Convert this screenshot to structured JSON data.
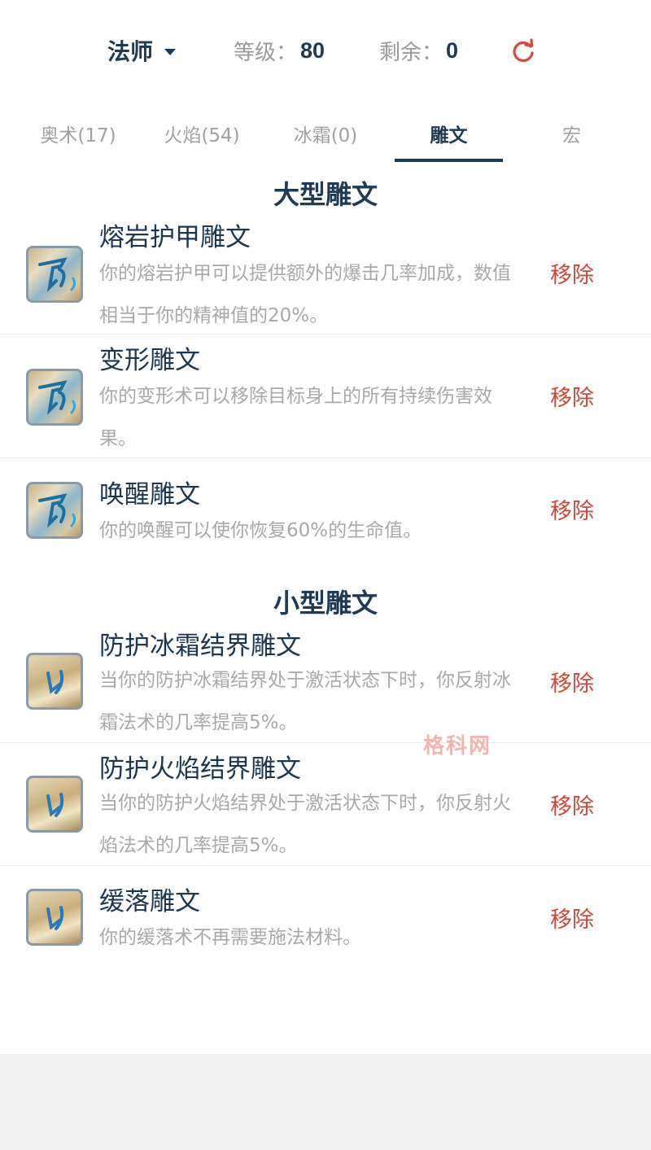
{
  "header": {
    "class_name": "法师",
    "level_label": "等级：",
    "level_value": "80",
    "remaining_label": "剩余：",
    "remaining_value": "0"
  },
  "tabs": [
    {
      "label": "奥术(17)",
      "active": false
    },
    {
      "label": "火焰(54)",
      "active": false
    },
    {
      "label": "冰霜(0)",
      "active": false
    },
    {
      "label": "雕文",
      "active": true
    },
    {
      "label": "宏",
      "active": false
    }
  ],
  "major": {
    "title": "大型雕文",
    "items": [
      {
        "name": "熔岩护甲雕文",
        "desc": "你的熔岩护甲可以提供额外的爆击几率加成，数值相当于你的精神值的20%。",
        "action": "移除",
        "icon": "glyph-major-icon"
      },
      {
        "name": "变形雕文",
        "desc": "你的变形术可以移除目标身上的所有持续伤害效果。",
        "action": "移除",
        "icon": "glyph-major-icon"
      },
      {
        "name": "唤醒雕文",
        "desc": "你的唤醒可以使你恢复60%的生命值。",
        "action": "移除",
        "icon": "glyph-major-icon"
      }
    ]
  },
  "minor": {
    "title": "小型雕文",
    "items": [
      {
        "name": "防护冰霜结界雕文",
        "desc": "当你的防护冰霜结界处于激活状态下时，你反射冰霜法术的几率提高5%。",
        "action": "移除",
        "icon": "glyph-minor-icon"
      },
      {
        "name": "防护火焰结界雕文",
        "desc": "当你的防护火焰结界处于激活状态下时，你反射火焰法术的几率提高5%。",
        "action": "移除",
        "icon": "glyph-minor-icon"
      },
      {
        "name": "缓落雕文",
        "desc": "你的缓落术不再需要施法材料。",
        "action": "移除",
        "icon": "glyph-minor-icon"
      }
    ]
  },
  "watermark": "格科网",
  "colors": {
    "primary": "#1f3a52",
    "remove": "#c8483a",
    "muted": "#a8a8a8"
  }
}
